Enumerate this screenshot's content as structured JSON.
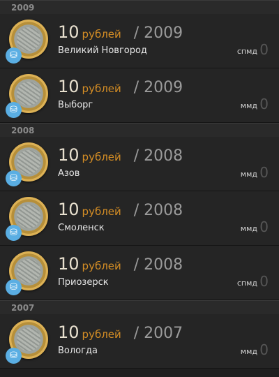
{
  "sections": [
    {
      "year": "2009",
      "items": [
        {
          "denom": "10",
          "currency": "рублей",
          "year": "/ 2009",
          "city": "Великий Новгород",
          "mint": "спмд",
          "count": "0"
        },
        {
          "denom": "10",
          "currency": "рублей",
          "year": "/ 2009",
          "city": "Выборг",
          "mint": "ммд",
          "count": "0"
        }
      ]
    },
    {
      "year": "2008",
      "items": [
        {
          "denom": "10",
          "currency": "рублей",
          "year": "/ 2008",
          "city": "Азов",
          "mint": "ммд",
          "count": "0"
        },
        {
          "denom": "10",
          "currency": "рублей",
          "year": "/ 2008",
          "city": "Смоленск",
          "mint": "ммд",
          "count": "0"
        },
        {
          "denom": "10",
          "currency": "рублей",
          "year": "/ 2008",
          "city": "Приозерск",
          "mint": "спмд",
          "count": "0"
        }
      ]
    },
    {
      "year": "2007",
      "items": [
        {
          "denom": "10",
          "currency": "рублей",
          "year": "/ 2007",
          "city": "Вологда",
          "mint": "ммд",
          "count": "0"
        }
      ]
    }
  ],
  "icons": {
    "basket": "basket-icon",
    "coin": "coin-image"
  },
  "colors": {
    "accent": "#d48d25",
    "basket": "#5aaee3",
    "background": "#1f1f1f"
  }
}
